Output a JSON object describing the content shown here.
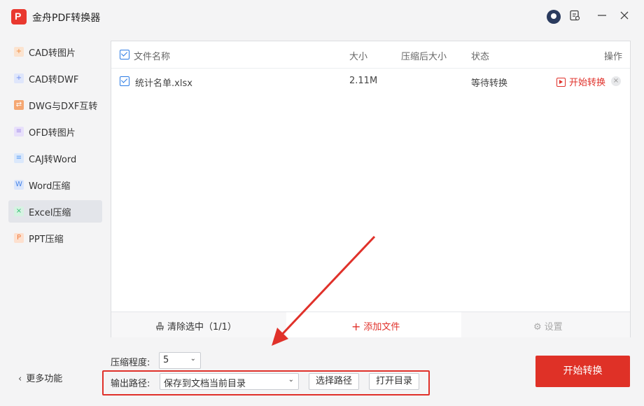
{
  "app": {
    "title": "金舟PDF转换器",
    "logo_letter": "P"
  },
  "titlebar": {
    "icons": [
      "user-avatar-icon",
      "feedback-icon",
      "minimize-icon",
      "close-icon"
    ]
  },
  "sidebar": {
    "items": [
      {
        "label": "CAD转图片",
        "icon": "cad-icon",
        "color": "#f08a3c"
      },
      {
        "label": "CAD转DWF",
        "icon": "cad-icon",
        "color": "#6c8cf0"
      },
      {
        "label": "DWG与DXF互转",
        "icon": "dwg-icon",
        "color": "#f08a3c"
      },
      {
        "label": "OFD转图片",
        "icon": "ofd-icon",
        "color": "#a58be8"
      },
      {
        "label": "CAJ转Word",
        "icon": "caj-icon",
        "color": "#5a9ef5"
      },
      {
        "label": "Word压缩",
        "icon": "word-icon",
        "color": "#4a86e8"
      },
      {
        "label": "Excel压缩",
        "icon": "excel-icon",
        "color": "#2fbf71"
      },
      {
        "label": "PPT压缩",
        "icon": "ppt-icon",
        "color": "#f0793c"
      }
    ],
    "active_index": 6,
    "more_label": "更多功能"
  },
  "table": {
    "columns": {
      "name": "文件名称",
      "size": "大小",
      "compressed_size": "压缩后大小",
      "status": "状态",
      "actions": "操作"
    },
    "rows": [
      {
        "checked": true,
        "name": "统计名单.xlsx",
        "size": "2.11M",
        "compressed_size": "",
        "status": "等待转换",
        "action": "开始转换"
      }
    ]
  },
  "bottom_bar": {
    "clear": "清除选中（1/1）",
    "add": "添加文件",
    "settings": "设置"
  },
  "options": {
    "compress_label": "压缩程度:",
    "compress_value": "5",
    "output_label": "输出路径:",
    "output_value": "保存到文档当前目录",
    "choose_path": "选择路径",
    "open_dir": "打开目录"
  },
  "start_button": "开始转换",
  "colors": {
    "accent_red": "#e0312a",
    "check_blue": "#2a7be4"
  }
}
